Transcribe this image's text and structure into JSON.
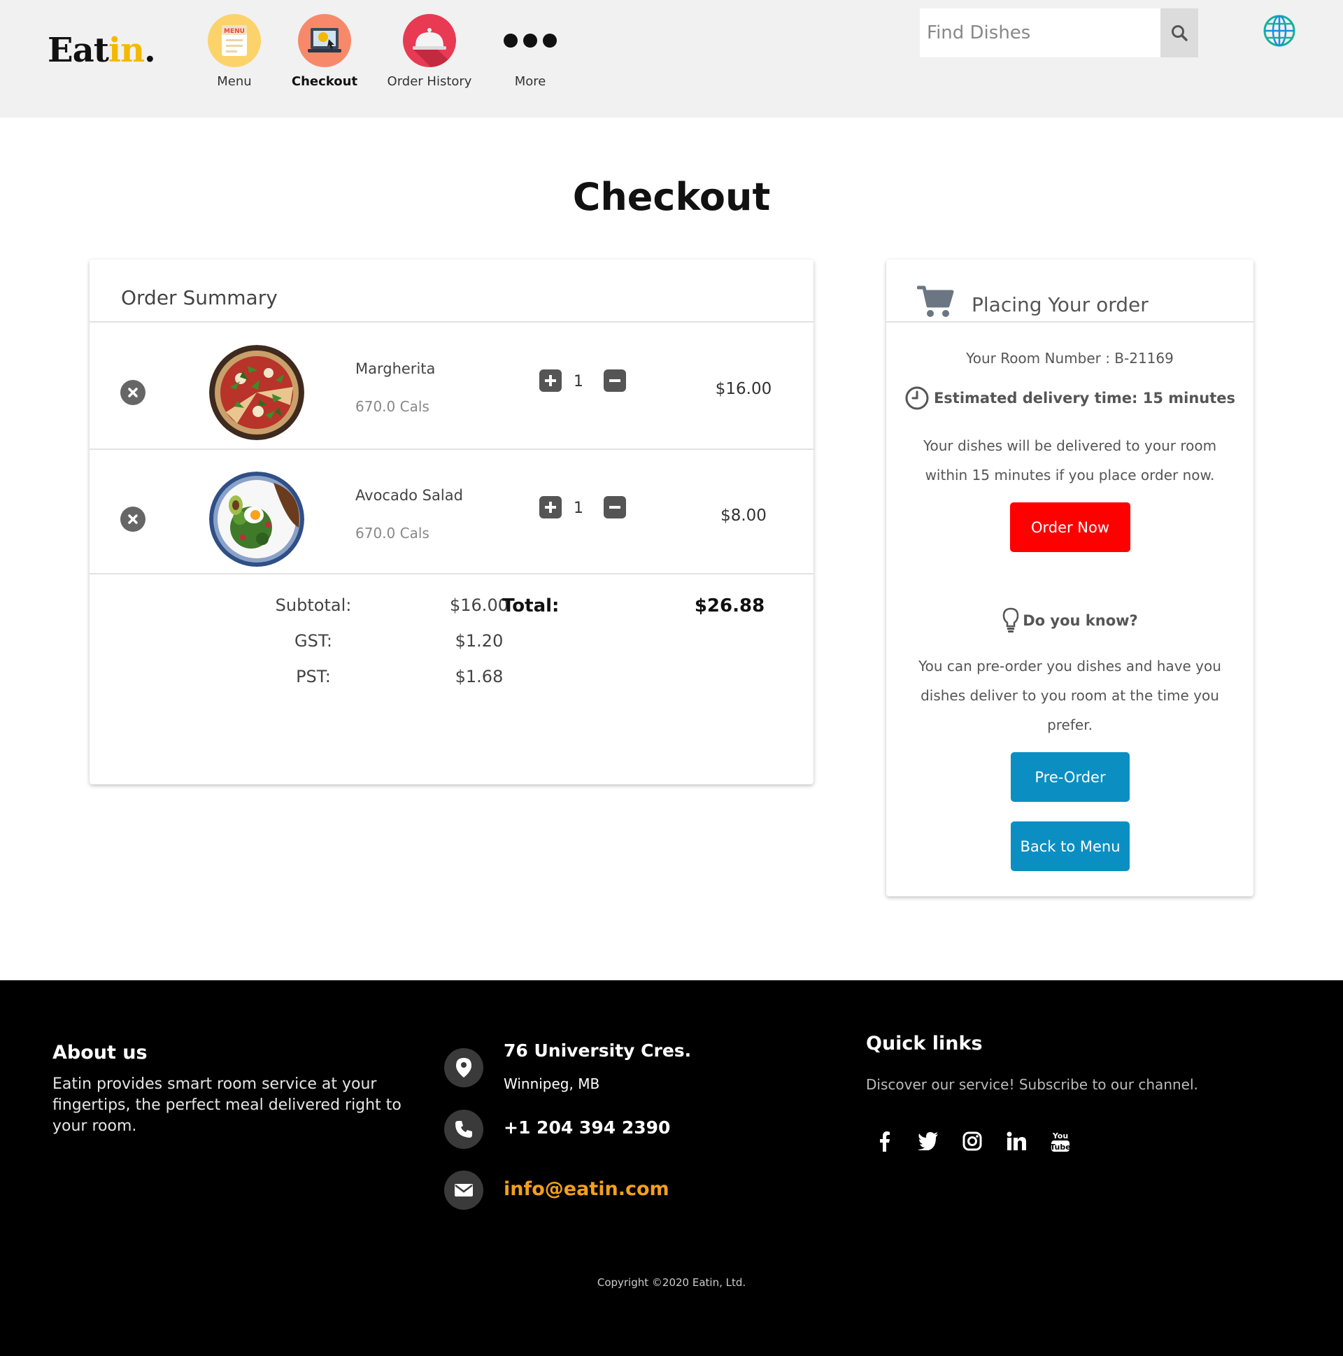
{
  "header": {
    "logo_main": "Eat",
    "logo_accent": "in",
    "logo_dot": ".",
    "nav": [
      {
        "label": "Menu",
        "icon": "menu-icon",
        "active": false
      },
      {
        "label": "Checkout",
        "icon": "checkout-icon",
        "active": true
      },
      {
        "label": "Order History",
        "icon": "order-history-icon",
        "active": false
      },
      {
        "label": "More",
        "icon": "more-icon",
        "active": false
      }
    ],
    "search": {
      "placeholder": "Find Dishes",
      "value": ""
    },
    "colors": {
      "accent": "#f5b800",
      "header_bg": "#f1f1f1"
    }
  },
  "page": {
    "title": "Checkout"
  },
  "order_summary": {
    "title": "Order Summary",
    "items": [
      {
        "name": "Margherita",
        "cals": "670.0 Cals",
        "qty": "1",
        "price": "$16.00"
      },
      {
        "name": "Avocado Salad",
        "cals": "670.0 Cals",
        "qty": "1",
        "price": "$8.00"
      }
    ],
    "subtotal_label": "Subtotal:",
    "subtotal": "$16.00",
    "gst_label": "GST:",
    "gst": "$1.20",
    "pst_label": "PST:",
    "pst": "$1.68",
    "total_label": "Total:",
    "total": "$26.88"
  },
  "placing": {
    "title": "Placing Your order",
    "room": "Your Room Number : B-21169",
    "eta": "Estimated delivery time: 15 minutes",
    "description": "Your dishes will be delivered to your room within 15 minutes if you place order now.",
    "order_now_label": "Order  Now",
    "did_you_know": "Do you know?",
    "did_you_know_text": "You can pre-order you dishes and have you dishes deliver to you room at the time you prefer.",
    "preorder_label": "Pre-Order",
    "back_label": "Back to Menu",
    "colors": {
      "order_button": "#ff0000",
      "secondary_button": "#0b8fc2"
    }
  },
  "footer": {
    "about_title": "About us",
    "about_text": "Eatin provides smart room service at your fingertips, the perfect meal delivered right to your room.",
    "address_line1": "76 University Cres.",
    "address_line2": "Winnipeg, MB",
    "phone": "+1 204 394 2390",
    "email": "info@eatin.com",
    "quick_links_title": "Quick links",
    "quick_links_text": "Discover our service! Subscribe to our channel.",
    "social": [
      "facebook-icon",
      "twitter-icon",
      "instagram-icon",
      "linkedin-icon",
      "youtube-icon"
    ],
    "youtube_line1": "You",
    "youtube_line2": "Tube",
    "copyright": "Copyright ©2020 Eatin, Ltd.",
    "colors": {
      "email": "#f3a01c"
    }
  }
}
